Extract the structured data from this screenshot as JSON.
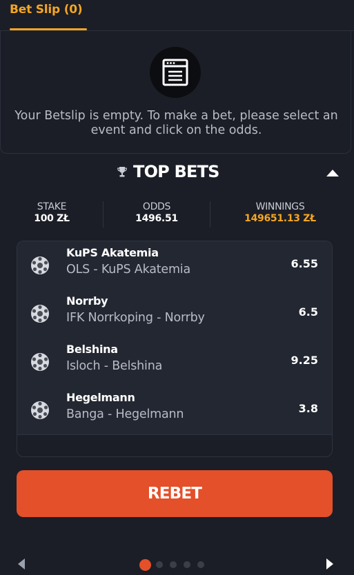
{
  "tabs": [
    {
      "label": "Bet Slip (0)",
      "active": true
    }
  ],
  "betslip": {
    "empty_message": "Your Betslip is empty. To make a bet, please select an event and click on the odds."
  },
  "top_bets": {
    "title": "TOP BETS",
    "stats": {
      "stake_label": "STAKE",
      "stake_value": "100 ZŁ",
      "odds_label": "ODDS",
      "odds_value": "1496.51",
      "winnings_label": "WINNINGS",
      "winnings_value": "149651.13 ZŁ"
    },
    "bets": [
      {
        "selection": "KuPS Akatemia",
        "match": "OLS - KuPS Akatemia",
        "odds": "6.55",
        "icon": "soccer-ball-icon"
      },
      {
        "selection": "Norrby",
        "match": "IFK Norrkoping - Norrby",
        "odds": "6.5",
        "icon": "soccer-ball-icon"
      },
      {
        "selection": "Belshina",
        "match": "Isloch - Belshina",
        "odds": "9.25",
        "icon": "soccer-ball-icon"
      },
      {
        "selection": "Hegelmann",
        "match": "Banga - Hegelmann",
        "odds": "3.8",
        "icon": "soccer-ball-icon"
      }
    ],
    "rebet_label": "REBET"
  },
  "pager": {
    "total_pages": 5,
    "active_page": 1
  },
  "colors": {
    "accent": "#f5a623",
    "button": "#e3502a",
    "background": "#1b1e26",
    "card": "#232731"
  }
}
